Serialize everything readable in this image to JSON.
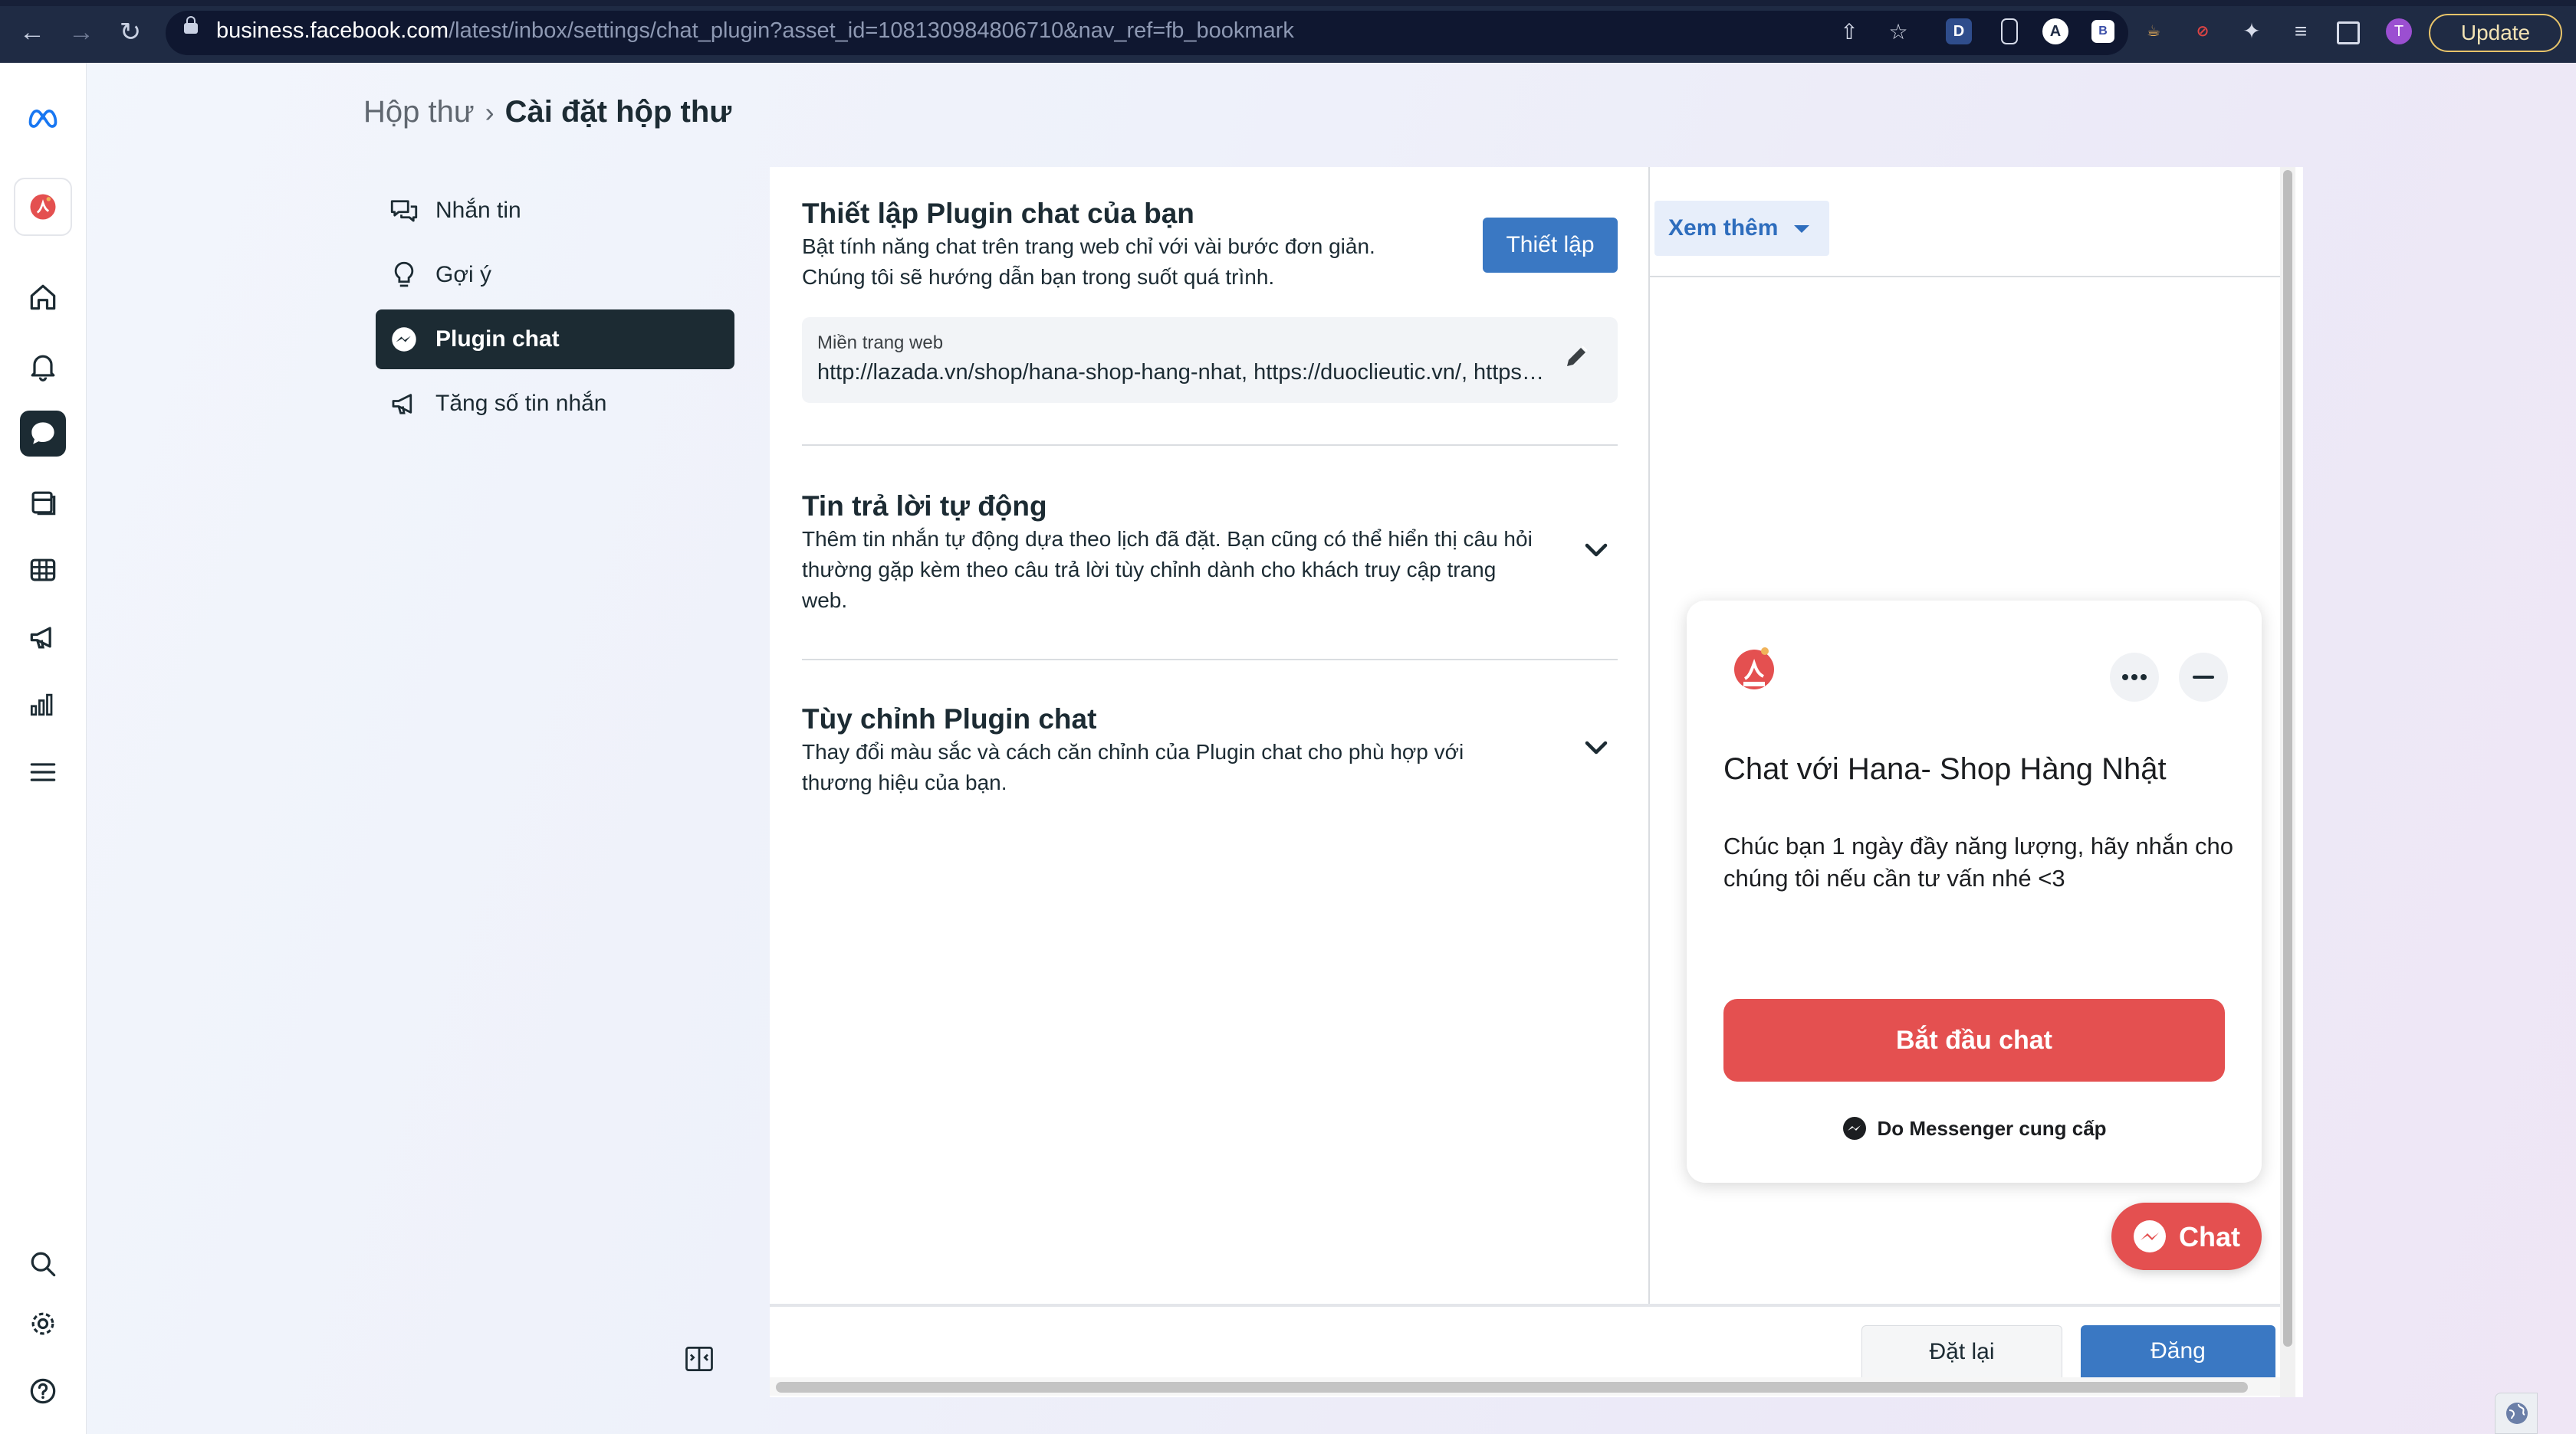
{
  "browser": {
    "url_host": "business.facebook.com",
    "url_path": "/latest/inbox/settings/chat_plugin?asset_id=108130984806710&nav_ref=fb_bookmark",
    "update_label": "Update",
    "extensions": [
      "D",
      "A",
      "B",
      "T"
    ]
  },
  "breadcrumb": {
    "parent": "Hộp thư",
    "current": "Cài đặt hộp thư"
  },
  "subnav": {
    "items": [
      {
        "label": "Nhắn tin",
        "icon": "chat-bubbles-icon"
      },
      {
        "label": "Gợi ý",
        "icon": "lightbulb-icon"
      },
      {
        "label": "Plugin chat",
        "icon": "messenger-icon",
        "active": true
      },
      {
        "label": "Tăng số tin nhắn",
        "icon": "megaphone-icon"
      }
    ]
  },
  "setup": {
    "title": "Thiết lập Plugin chat của bạn",
    "desc_line1": "Bật tính năng chat trên trang web chỉ với vài bước đơn giản.",
    "desc_line2": "Chúng tôi sẽ hướng dẫn bạn trong suốt quá trình.",
    "button": "Thiết lập",
    "domain_label": "Miền trang web",
    "domain_value": "http://lazada.vn/shop/hana-shop-hang-nhat, https://duoclieutic.vn/, https://hanashop.vn/"
  },
  "auto_reply": {
    "title": "Tin trả lời tự động",
    "desc": "Thêm tin nhắn tự động dựa theo lịch đã đặt. Bạn cũng có thể hiển thị câu hỏi thường gặp kèm theo câu trả lời tùy chỉnh dành cho khách truy cập trang web."
  },
  "customize": {
    "title": "Tùy chỉnh Plugin chat",
    "desc": "Thay đổi màu sắc và cách căn chỉnh của Plugin chat cho phù hợp với thương hiệu của bạn."
  },
  "preview": {
    "more_label": "Xem thêm",
    "card_title": "Chat với Hana- Shop Hàng Nhật",
    "greeting": "Chúc bạn 1 ngày đầy năng lượng, hãy nhắn cho chúng tôi nếu cần tư vấn nhé <3",
    "start_button": "Bắt đầu chat",
    "powered_by": "Do Messenger cung cấp",
    "bubble_label": "Chat",
    "accent_color": "#e45050"
  },
  "footer": {
    "reset": "Đặt lại",
    "publish": "Đăng"
  },
  "colors": {
    "primary_blue": "#3a78c3",
    "nav_active": "#1c2b33"
  }
}
